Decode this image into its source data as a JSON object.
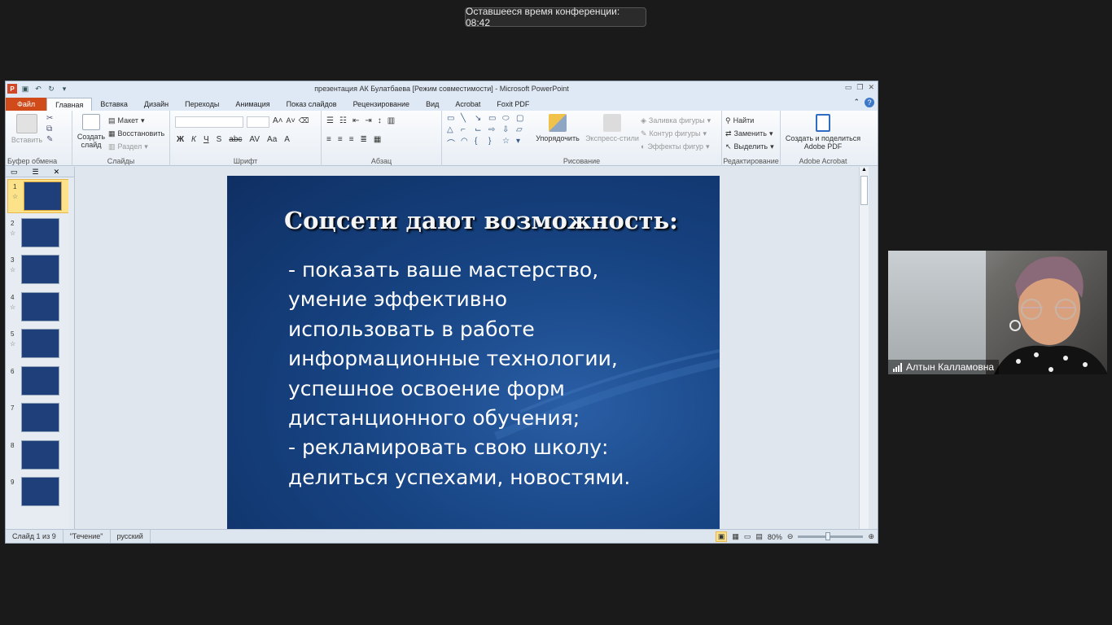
{
  "conference_timer": "Оставшееся время конференции: 08:42",
  "window": {
    "title": "презентация АК Булатбаева [Режим совместимости]  -  Microsoft PowerPoint",
    "app_icon": "P"
  },
  "tabs": [
    "Файл",
    "Главная",
    "Вставка",
    "Дизайн",
    "Переходы",
    "Анимация",
    "Показ слайдов",
    "Рецензирование",
    "Вид",
    "Acrobat",
    "Foxit PDF"
  ],
  "active_tab": "Главная",
  "ribbon": {
    "clipboard": {
      "label": "Буфер обмена",
      "paste": "Вставить"
    },
    "slides": {
      "label": "Слайды",
      "new_slide": "Создать слайд",
      "layout": "Макет",
      "reset": "Восстановить",
      "section": "Раздел"
    },
    "font": {
      "label": "Шрифт"
    },
    "paragraph": {
      "label": "Абзац"
    },
    "drawing": {
      "label": "Рисование",
      "arrange": "Упорядочить",
      "quick_styles": "Экспресс-стили",
      "shape_fill": "Заливка фигуры",
      "shape_outline": "Контур фигуры",
      "shape_effects": "Эффекты фигур"
    },
    "editing": {
      "label": "Редактирование",
      "find": "Найти",
      "replace": "Заменить",
      "select": "Выделить"
    },
    "acrobat": {
      "label": "Adobe Acrobat",
      "create_share": "Создать и поделиться Adobe PDF"
    }
  },
  "thumbnails": [
    {
      "num": "1",
      "active": true
    },
    {
      "num": "2",
      "active": false
    },
    {
      "num": "3",
      "active": false
    },
    {
      "num": "4",
      "active": false
    },
    {
      "num": "5",
      "active": false
    },
    {
      "num": "6",
      "active": false
    },
    {
      "num": "7",
      "active": false
    },
    {
      "num": "8",
      "active": false
    },
    {
      "num": "9",
      "active": false
    }
  ],
  "slide": {
    "title": "Соцсети дают возможность:",
    "body": "- показать ваше мастерство,\nумение эффективно\nиспользовать в работе\nинформационные технологии,\nуспешное освоение форм\nдистанционного обучения;\n- рекламировать свою школу:\nделиться успехами, новостями."
  },
  "status": {
    "slide_counter": "Слайд 1 из 9",
    "theme": "\"Течение\"",
    "language": "русский",
    "zoom": "80%"
  },
  "video": {
    "participant": "Алтын Калламовна"
  }
}
